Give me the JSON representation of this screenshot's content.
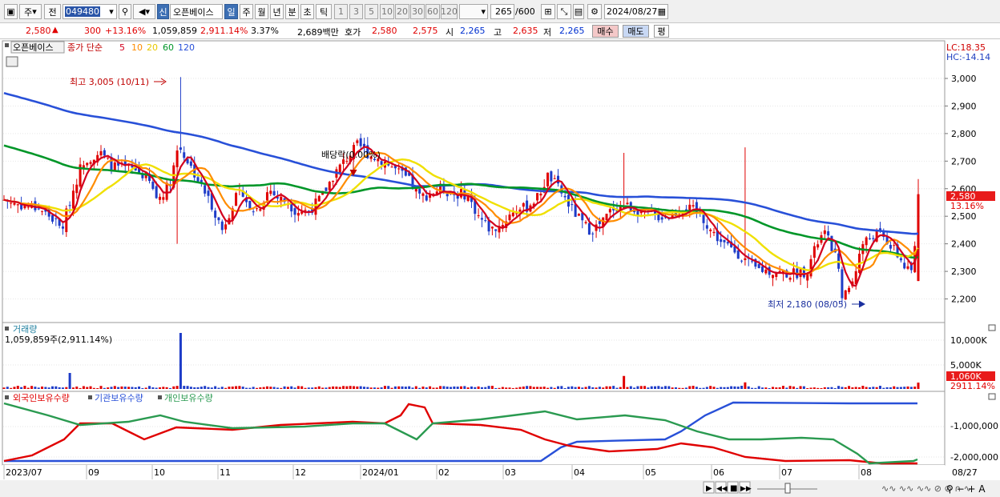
{
  "toolbar": {
    "market": "주",
    "prev": "전",
    "code": "049480",
    "name": "오픈베이스",
    "period_sel": "일",
    "periods": [
      "주",
      "월",
      "년",
      "분",
      "초",
      "틱"
    ],
    "nums": [
      "1",
      "3",
      "5",
      "10",
      "20",
      "30",
      "60",
      "120"
    ],
    "count": "265",
    "total": "/600",
    "date": "2024/08/27"
  },
  "info": {
    "price": "2,580",
    "arrow": "▲",
    "change": "300",
    "change_pct": "+13.16%",
    "volume": "1,059,859",
    "vol_pct": "2,911.14%",
    "turnover": "3.37%",
    "amount": "2,689백만",
    "quote_label": "호가",
    "ask": "2,580",
    "bid": "2,575",
    "open_label": "시",
    "open": "2,265",
    "high_label": "고",
    "high": "2,635",
    "low_label": "저",
    "low": "2,265",
    "buy": "매수",
    "sell": "매도",
    "eval": "평"
  },
  "price_panel": {
    "title": "오픈베이스",
    "ma_label": "종가 단순",
    "mas": [
      "5",
      "10",
      "20",
      "60",
      "120"
    ],
    "lc": "LC:18.35",
    "hc": "HC:-14.14",
    "max_label": "최고 3,005 (10/11)",
    "min_label": "최저 2,180 (08/05)",
    "div_label": "배당락(0.00%)",
    "cur_price": "2,580",
    "cur_pct": "13.16%",
    "y_ticks": [
      "3,000",
      "2,900",
      "2,800",
      "2,700",
      "2,600",
      "2,500",
      "2,400",
      "2,300",
      "2,200"
    ]
  },
  "vol_panel": {
    "title": "거래량",
    "value": "1,059,859주(2,911.14%)",
    "ticks": [
      "10,000K",
      "5,000K"
    ],
    "cur": "1,060K",
    "cur_pct": "2911.14%"
  },
  "hold_panel": {
    "s1": "외국인보유수량",
    "s2": "기관보유수량",
    "s3": "개인보유수량",
    "ticks": [
      "-1,000,000",
      "-2,000,000"
    ]
  },
  "x_axis": {
    "labels": [
      "2023/07",
      "09",
      "10",
      "11",
      "12",
      "2024/01",
      "02",
      "03",
      "04",
      "05",
      "06",
      "07",
      "08",
      "08/27"
    ]
  },
  "colors": {
    "up": "#e00000",
    "down": "#1e3cc8",
    "ma5": "#d2001e",
    "ma10": "#ff8c00",
    "ma20": "#f0e000",
    "ma60": "#009628",
    "ma120": "#2850d8",
    "foreign": "#e00000",
    "inst": "#2850d8",
    "indiv": "#2a9a50"
  }
}
